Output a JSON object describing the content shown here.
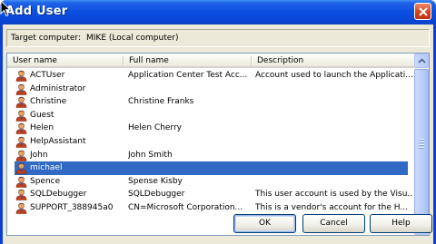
{
  "window": {
    "title": "Add User"
  },
  "target": {
    "label": "Target computer:",
    "value": "MIKE (Local computer)"
  },
  "columns": [
    "User name",
    "Full name",
    "Description"
  ],
  "users": [
    {
      "name": "ACTUser",
      "full": "Application Center Test Acc...",
      "desc": "Account used to launch the Applicati..."
    },
    {
      "name": "Administrator",
      "full": "",
      "desc": ""
    },
    {
      "name": "Christine",
      "full": "Christine Franks",
      "desc": ""
    },
    {
      "name": "Guest",
      "full": "",
      "desc": ""
    },
    {
      "name": "Helen",
      "full": "Helen Cherry",
      "desc": ""
    },
    {
      "name": "HelpAssistant",
      "full": "",
      "desc": ""
    },
    {
      "name": "John",
      "full": "John Smith",
      "desc": ""
    },
    {
      "name": "michael",
      "full": "",
      "desc": "",
      "selected": true
    },
    {
      "name": "Spence",
      "full": "Spense Kisby",
      "desc": ""
    },
    {
      "name": "SQLDebugger",
      "full": "SQLDebugger",
      "desc": "This user account is used by the Visu..."
    },
    {
      "name": "SUPPORT_388945a0",
      "full": "CN=Microsoft Corporation...",
      "desc": "This is a vendor's account for the H..."
    }
  ],
  "buttons": {
    "ok": "OK",
    "cancel": "Cancel",
    "help": "Help"
  },
  "colors": {
    "titlebar": "#0a46d6",
    "selection": "#316ac5",
    "dialog_bg": "#ece9d8"
  }
}
